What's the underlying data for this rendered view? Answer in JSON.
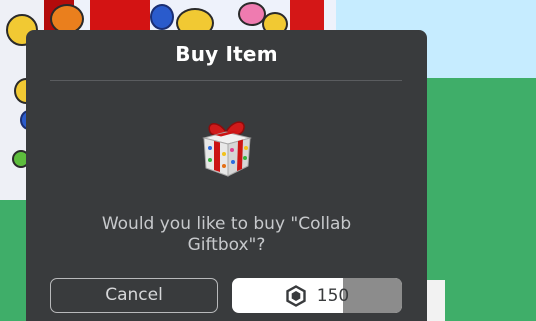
{
  "dialog": {
    "title": "Buy Item",
    "prompt": "Would you like to buy \"Collab Giftbox\"?",
    "cancel_label": "Cancel",
    "price": "150",
    "price_icon": "robux-icon",
    "buy_hold_progress": 0.35
  },
  "colors": {
    "dialog_bg": "#393b3d",
    "buy_bg": "#ffffff",
    "progress": "#8c8c8c",
    "grass": "#3fae69",
    "ribbon": "#cf1010"
  }
}
